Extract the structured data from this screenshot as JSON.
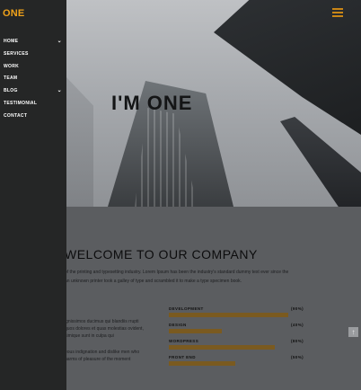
{
  "brand": {
    "logo": "ONE"
  },
  "hero": {
    "title": "I'M ONE"
  },
  "welcome": {
    "heading": "WELCOME TO OUR COMPANY",
    "intro": "of the printing and typesetting industry. Lorem Ipsum has been the industry's standard dummy text ever since the an unknown printer took a galley of type and scrambled it to make a type specimen book."
  },
  "side_text": {
    "p1": "ignissimos ducimus qui blandiis rrupti quos dolores et quas molestias ovident, simique sunt in culpa qui",
    "p2": "eous indignation and dislike men who harms of pleasure of the moment"
  },
  "sidebar": {
    "items": [
      {
        "label": "HOME",
        "chevron": true
      },
      {
        "label": "SERVICES",
        "chevron": false
      },
      {
        "label": "WORK",
        "chevron": false
      },
      {
        "label": "TEAM",
        "chevron": false
      },
      {
        "label": "BLOG",
        "chevron": true
      },
      {
        "label": "TESTIMONIAL",
        "chevron": false
      },
      {
        "label": "CONTACT",
        "chevron": false
      }
    ]
  },
  "skills": [
    {
      "name": "DEVELOPMENT",
      "percent_label": "(90%)",
      "value": 0.9
    },
    {
      "name": "DESIGN",
      "percent_label": "(40%)",
      "value": 0.4
    },
    {
      "name": "WORDPRESS",
      "percent_label": "(80%)",
      "value": 0.8
    },
    {
      "name": "FRONT END",
      "percent_label": "(50%)",
      "value": 0.5
    }
  ],
  "icons": {
    "menu": "hamburger-icon",
    "chevron": "chevron-down-icon",
    "scroll_top": "arrow-up-icon"
  },
  "colors": {
    "accent": "#f0a21a",
    "bar": "#7a5a20",
    "sidebar": "#252626"
  }
}
